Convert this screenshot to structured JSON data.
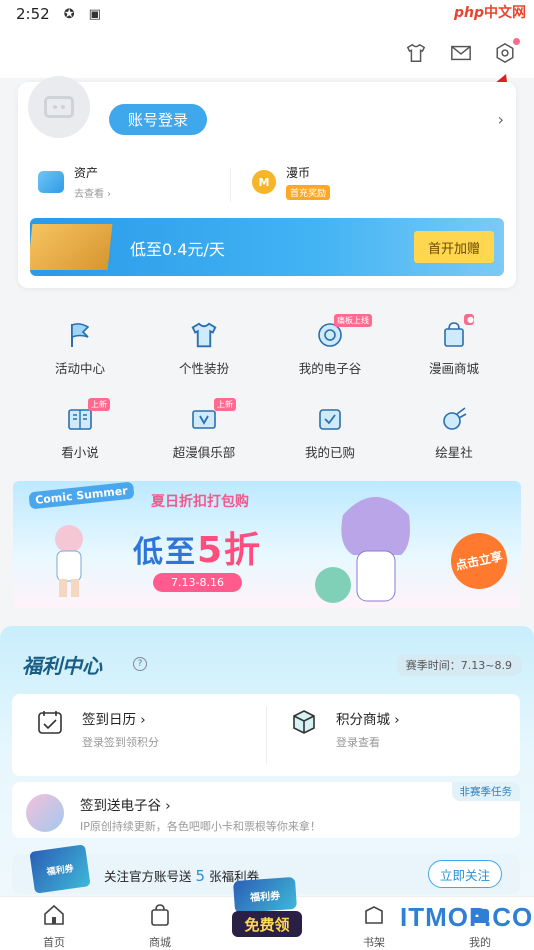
{
  "status": {
    "time": "2:52"
  },
  "watermark": {
    "php": "php",
    "cn": "中文网",
    "bottom": "ITMOP.COM"
  },
  "profile": {
    "login_label": "账号登录",
    "assets_label": "资产",
    "assets_sub": "去查看",
    "manbi_label": "漫币",
    "manbi_badge": "首充奖励"
  },
  "vip": {
    "text": "低至0.4元/天",
    "button": "首开加赠"
  },
  "functions": [
    {
      "label": "活动中心",
      "icon": "flag-icon"
    },
    {
      "label": "个性装扮",
      "icon": "tshirt-icon"
    },
    {
      "label": "我的电子谷",
      "icon": "badge-icon",
      "tag": "痛板上线"
    },
    {
      "label": "漫画商城",
      "icon": "shop-bag-icon"
    },
    {
      "label": "看小说",
      "icon": "book-icon",
      "tag": "上新"
    },
    {
      "label": "超漫俱乐部",
      "icon": "vip-club-icon",
      "tag": "上新"
    },
    {
      "label": "我的已购",
      "icon": "purchased-icon"
    },
    {
      "label": "绘星社",
      "icon": "meteor-icon"
    }
  ],
  "promo": {
    "logo": "Comic Summer",
    "subtitle": "夏日折扣打包购",
    "main_prefix": "低至",
    "main_highlight": "5折",
    "date": "7.13-8.16",
    "cta": "点击立享"
  },
  "welfare": {
    "title": "福利中心",
    "help": "?",
    "season": "赛季时间：7.13~8.9",
    "signin_title": "签到日历",
    "signin_sub": "登录签到领积分",
    "points_title": "积分商城",
    "points_sub": "登录查看",
    "task_tag": "非赛季任务",
    "task_title": "签到送电子谷",
    "task_desc": "IP原创持续更新，各色吧唧小卡和票根等你来拿！",
    "follow_prefix": "关注官方账号送",
    "follow_num": "5",
    "follow_suffix": "张福利券",
    "follow_btn": "立即关注",
    "ticket_label": "福利券"
  },
  "nav": {
    "home": "首页",
    "mall": "商城",
    "free_top": "福利券",
    "free": "免费领",
    "shelf": "书架",
    "me": "我的"
  },
  "colors": {
    "accent": "#3fa7ec",
    "pink": "#ff6b8f",
    "gold": "#ffd64f"
  }
}
